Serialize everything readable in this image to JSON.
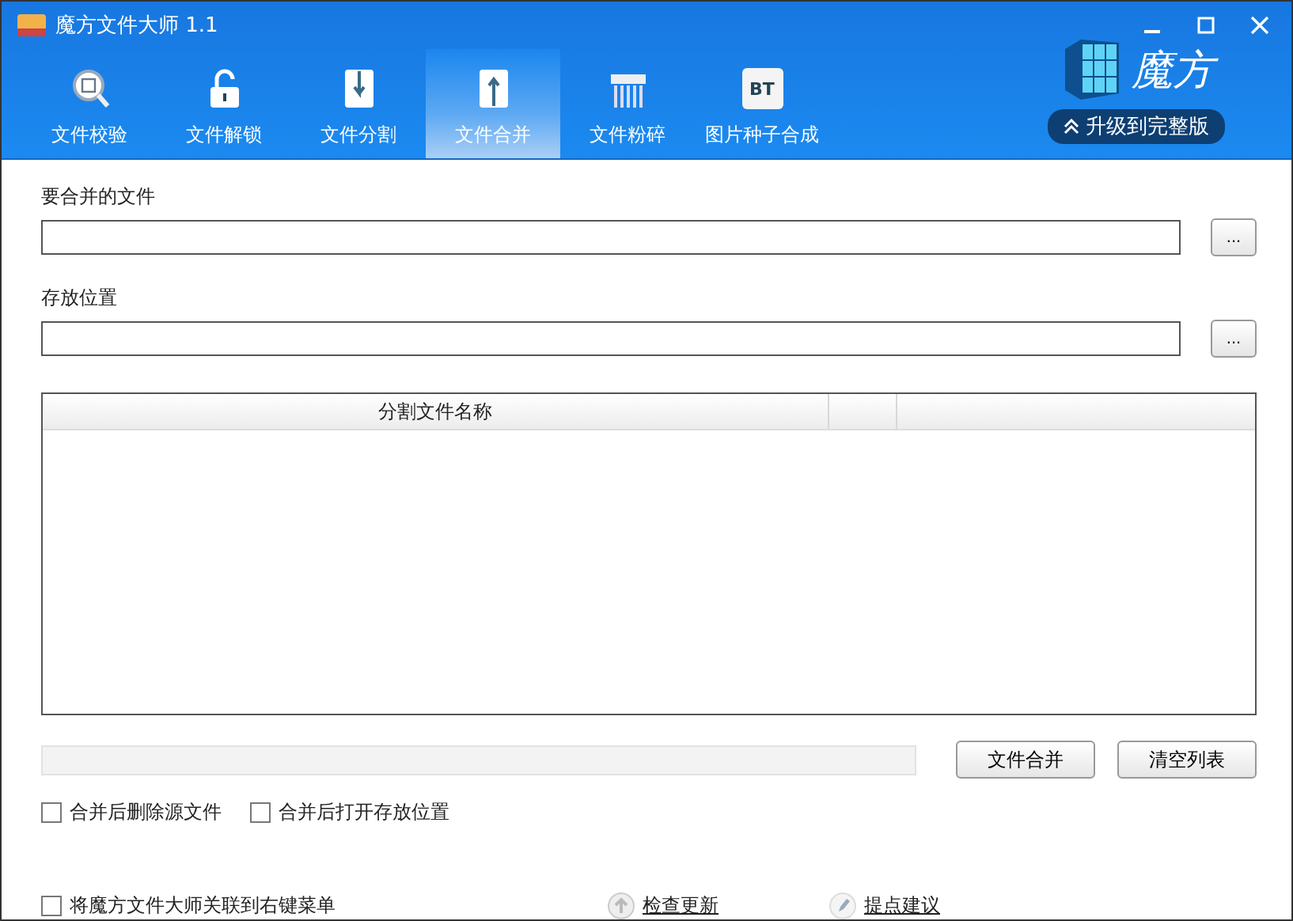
{
  "window": {
    "title": "魔方文件大师 1.1"
  },
  "tabs": [
    {
      "label": "文件校验",
      "kind": "verify",
      "selected": false
    },
    {
      "label": "文件解锁",
      "kind": "unlock",
      "selected": false
    },
    {
      "label": "文件分割",
      "kind": "split",
      "selected": false
    },
    {
      "label": "文件合并",
      "kind": "merge",
      "selected": true
    },
    {
      "label": "文件粉碎",
      "kind": "shred",
      "selected": false
    },
    {
      "label": "图片种子合成",
      "kind": "bt",
      "icon_text": "BT",
      "selected": false
    }
  ],
  "brand": {
    "name": "魔方",
    "upgrade": "升级到完整版"
  },
  "fields": [
    {
      "label": "要合并的文件",
      "browse": "..."
    },
    {
      "label": "存放位置",
      "browse": "..."
    }
  ],
  "table": {
    "columns": [
      "分割文件名称"
    ]
  },
  "progress": {
    "level": 0
  },
  "buttons": [
    "文件合并",
    "清空列表"
  ],
  "options": [
    {
      "label": "合并后删除源文件",
      "checked": false
    },
    {
      "label": "合并后打开存放位置",
      "checked": false
    }
  ],
  "footer": {
    "context_menu": {
      "label": "将魔方文件大师关联到右键菜单",
      "checked": false
    },
    "links": [
      {
        "kind": "update",
        "label": "检查更新"
      },
      {
        "kind": "suggest",
        "label": "提点建议"
      }
    ]
  }
}
